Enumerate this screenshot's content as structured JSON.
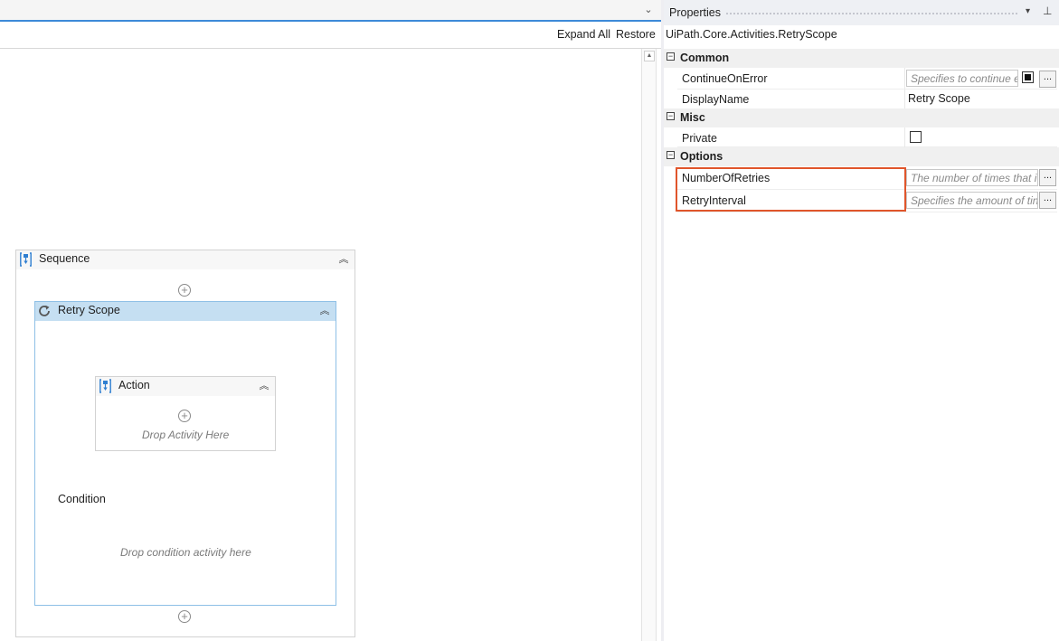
{
  "designer": {
    "toolbar": {
      "expand_all": "Expand All",
      "restore": "Restore"
    },
    "sequence": {
      "title": "Sequence",
      "retry_scope": {
        "title": "Retry Scope",
        "action": {
          "title": "Action",
          "drop_hint": "Drop Activity Here"
        },
        "condition_label": "Condition",
        "condition_hint": "Drop condition activity here"
      }
    }
  },
  "properties": {
    "title": "Properties",
    "type_name": "UiPath.Core.Activities.RetryScope",
    "categories": [
      {
        "name": "Common",
        "rows": [
          {
            "name": "ContinueOnError",
            "placeholder": "Specifies to continue e"
          },
          {
            "name": "DisplayName",
            "value": "Retry Scope"
          }
        ]
      },
      {
        "name": "Misc",
        "rows": [
          {
            "name": "Private",
            "checked": false
          }
        ]
      },
      {
        "name": "Options",
        "rows": [
          {
            "name": "NumberOfRetries",
            "placeholder": "The number of times that i"
          },
          {
            "name": "RetryInterval",
            "placeholder": "Specifies the amount of tin"
          }
        ]
      }
    ],
    "ellipsis": "...",
    "toggle_symbol": "−"
  },
  "colors": {
    "accent": "#3d8ad8",
    "retry_scope_header": "#c5dff2",
    "retry_scope_border": "#8ec0e6",
    "highlight": "#e0552b",
    "activity_icon": "#2f7fd1"
  },
  "icons": {
    "tab_dropdown": "chevron-down-icon",
    "collapse": "double-chevron-up-icon",
    "add": "plus-circle-icon",
    "sequence": "sequence-icon",
    "retry": "retry-icon",
    "pin": "pin-icon"
  }
}
